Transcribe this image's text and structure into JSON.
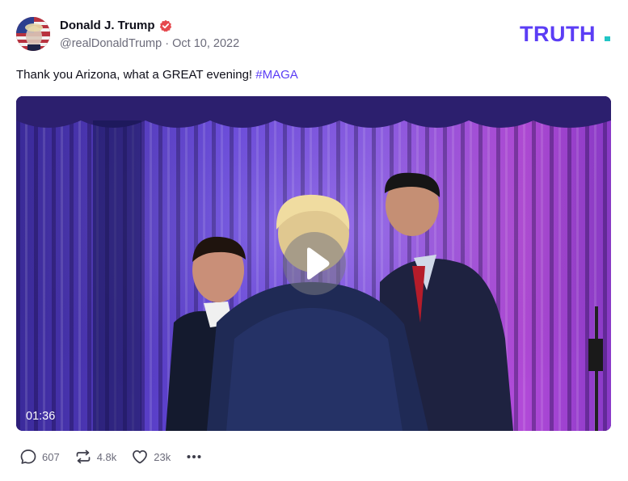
{
  "author": {
    "display_name": "Donald J. Trump",
    "handle": "@realDonaldTrump",
    "separator": "·",
    "date": "Oct 10, 2022",
    "verified_icon": "verified-badge-icon"
  },
  "brand": {
    "logo_text": "TRUTH",
    "logo_dot": ".",
    "color": "#5b3df5",
    "dot_color": "#22c5c5"
  },
  "post": {
    "text": "Thank you Arizona, what a GREAT evening!",
    "hashtag": "#MAGA"
  },
  "media": {
    "type": "video",
    "duration": "01:36",
    "play_icon": "play-icon"
  },
  "actions": {
    "replies": "607",
    "retruths": "4.8k",
    "likes": "23k",
    "reply_icon": "comment-icon",
    "retruth_icon": "retruth-icon",
    "like_icon": "heart-icon",
    "more_icon": "more-icon"
  },
  "colors": {
    "accent": "#5b3df5",
    "muted_text": "#6b6b7a",
    "verified": "#e5484d"
  }
}
